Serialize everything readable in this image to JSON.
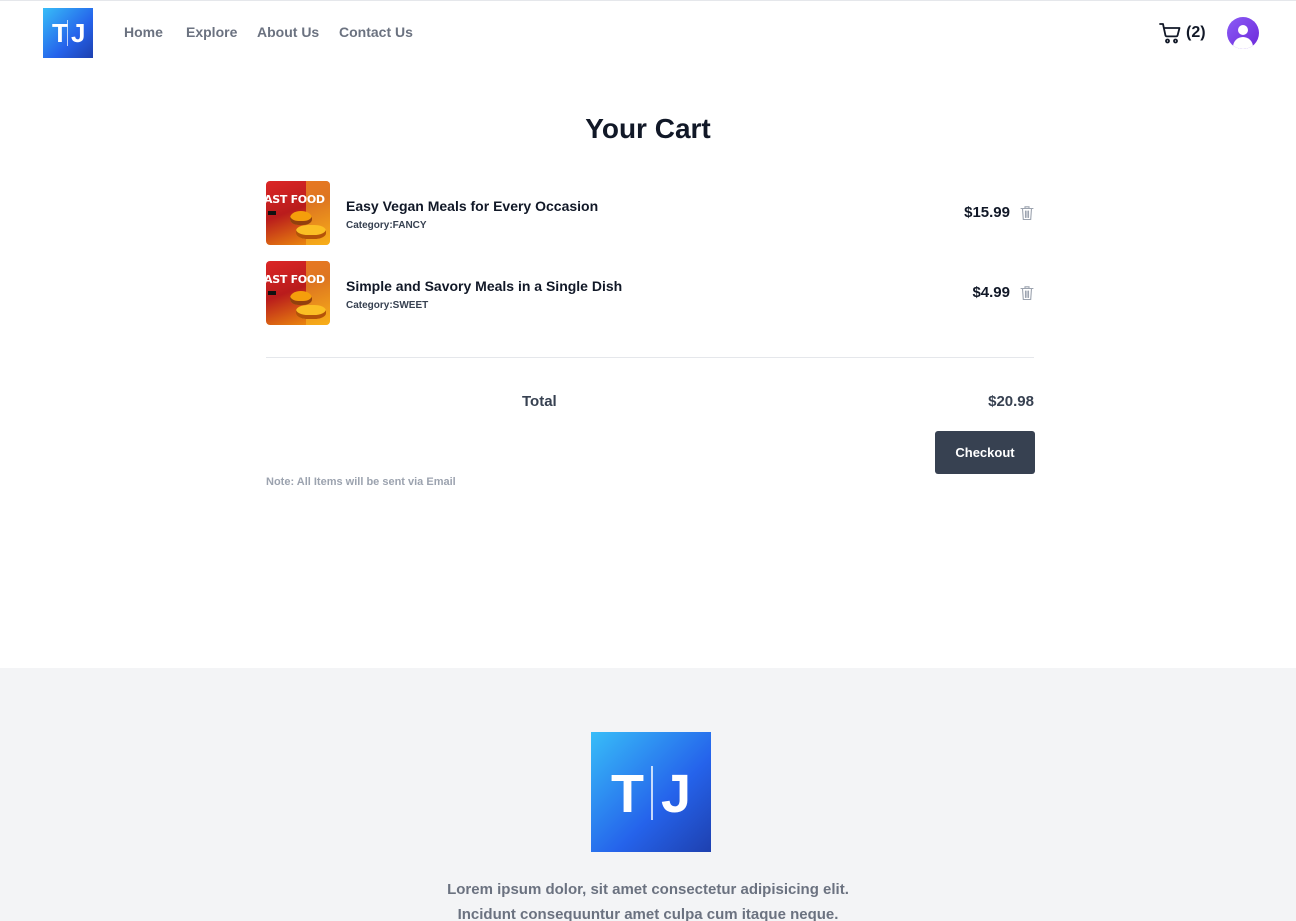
{
  "header": {
    "logo_letters": [
      "T",
      "J"
    ],
    "nav": [
      "Home",
      "Explore",
      "About Us",
      "Contact Us"
    ],
    "cart_count": "(2)"
  },
  "main": {
    "title": "Your Cart",
    "items": [
      {
        "title": "Easy Vegan Meals for Every Occasion",
        "category": "Category:FANCY",
        "price": "$15.99",
        "thumb_text": "AST FOOD"
      },
      {
        "title": "Simple and Savory Meals in a Single Dish",
        "category": "Category:SWEET",
        "price": "$4.99",
        "thumb_text": "AST FOOD"
      }
    ],
    "total_label": "Total",
    "total_value": "$20.98",
    "checkout_label": "Checkout",
    "note": "Note: All Items will be sent via Email"
  },
  "footer": {
    "logo_letters": [
      "T",
      "J"
    ],
    "text_line1": "Lorem ipsum dolor, sit amet consectetur adipisicing elit.",
    "text_line2": "Incidunt consequuntur amet culpa cum itaque neque."
  },
  "icons": {
    "cart": "shopping-cart-icon",
    "trash": "trash-icon",
    "avatar": "user-avatar-icon"
  },
  "colors": {
    "brand_gradient_start": "#38bdf8",
    "brand_gradient_end": "#1e40af",
    "button": "#374151",
    "avatar": "#7c3aed"
  }
}
